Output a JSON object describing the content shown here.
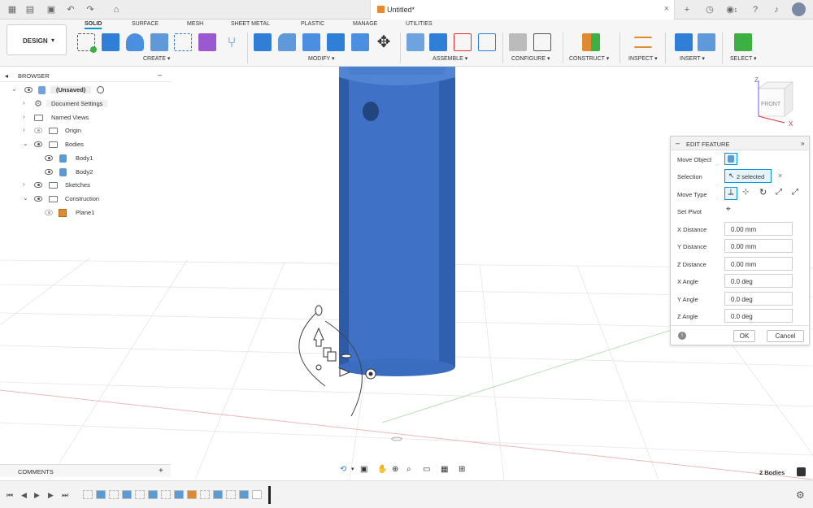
{
  "app": {
    "document_title": "Untitled*",
    "notification_count": "1",
    "workspace": "DESIGN"
  },
  "tabs": [
    "SOLID",
    "SURFACE",
    "MESH",
    "SHEET METAL",
    "PLASTIC",
    "MANAGE",
    "UTILITIES"
  ],
  "groups": [
    "CREATE",
    "MODIFY",
    "ASSEMBLE",
    "CONFIGURE",
    "CONSTRUCT",
    "INSPECT",
    "INSERT",
    "SELECT"
  ],
  "browser": {
    "title": "BROWSER",
    "root": "(Unsaved)",
    "items": [
      "Document Settings",
      "Named Views",
      "Origin",
      "Bodies",
      "Body1",
      "Body2",
      "Sketches",
      "Construction",
      "Plane1"
    ]
  },
  "edit_feature": {
    "title": "EDIT FEATURE",
    "move_object_label": "Move Object",
    "selection_label": "Selection",
    "selection_value": "2 selected",
    "move_type_label": "Move Type",
    "set_pivot_label": "Set Pivot",
    "fields": [
      {
        "label": "X Distance",
        "value": "0.00 mm"
      },
      {
        "label": "Y Distance",
        "value": "0.00 mm"
      },
      {
        "label": "Z Distance",
        "value": "0.00 mm"
      },
      {
        "label": "X Angle",
        "value": "0.0 deg"
      },
      {
        "label": "Y Angle",
        "value": "0.0 deg"
      },
      {
        "label": "Z Angle",
        "value": "0.0 deg"
      }
    ],
    "ok_label": "OK",
    "cancel_label": "Cancel"
  },
  "viewcube": {
    "face": "FRONT",
    "axis_z": "Z",
    "axis_x": "X"
  },
  "comments_label": "COMMENTS",
  "bodies_count": "2 Bodies",
  "colors": {
    "accent": "#0696d7",
    "body": "#3f72c6"
  }
}
